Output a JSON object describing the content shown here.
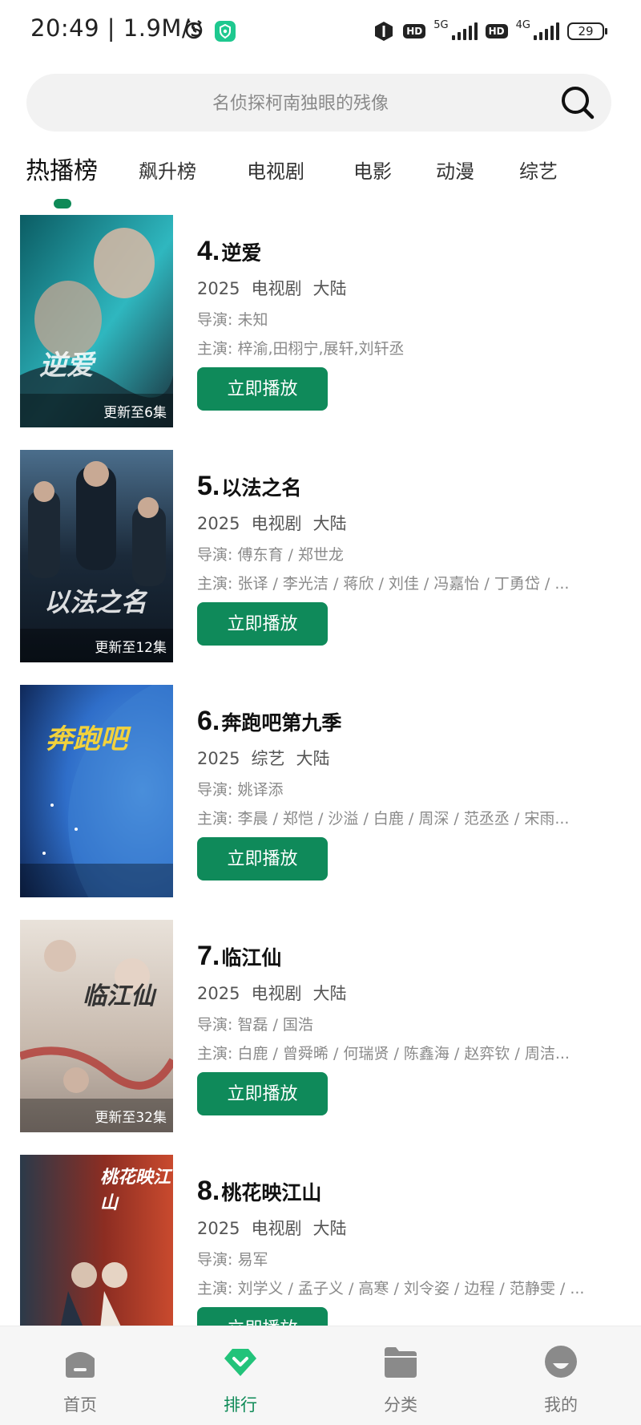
{
  "status_bar": {
    "time_speed": "20:49 | 1.9M/s",
    "hd_badge": "HD",
    "net_5g": "5G",
    "net_4g": "4G",
    "battery": "29"
  },
  "search": {
    "placeholder": "名侦探柯南独眼的残像"
  },
  "tabs": [
    {
      "label": "热播榜",
      "active": true
    },
    {
      "label": "飙升榜",
      "active": false
    },
    {
      "label": "电视剧",
      "active": false
    },
    {
      "label": "电影",
      "active": false
    },
    {
      "label": "动漫",
      "active": false
    },
    {
      "label": "综艺",
      "active": false
    }
  ],
  "items": [
    {
      "rank": "4.",
      "title": "逆爱",
      "year": "2025",
      "type": "电视剧",
      "region": "大陆",
      "director": "导演: 未知",
      "cast": "主演: 梓渝,田栩宁,展轩,刘轩丞",
      "badge": "更新至6集",
      "poster_text": "逆爱",
      "poster_colors": [
        "#0b5c63",
        "#2fb7bf",
        "#1a2f3a"
      ]
    },
    {
      "rank": "5.",
      "title": "以法之名",
      "year": "2025",
      "type": "电视剧",
      "region": "大陆",
      "director": "导演: 傅东育 / 郑世龙",
      "cast": "主演: 张译 / 李光洁 / 蒋欣 / 刘佳 / 冯嘉怡 / 丁勇岱 / ...",
      "badge": "更新至12集",
      "poster_text": "以法之名",
      "poster_colors": [
        "#1b2a3a",
        "#4b6e8c",
        "#0d1620"
      ]
    },
    {
      "rank": "6.",
      "title": "奔跑吧第九季",
      "year": "2025",
      "type": "综艺",
      "region": "大陆",
      "director": "导演: 姚译添",
      "cast": "主演: 李晨 / 郑恺 / 沙溢 / 白鹿 / 周深 / 范丞丞 / 宋雨...",
      "badge": "",
      "poster_text": "奔跑吧",
      "poster_colors": [
        "#0b1f4a",
        "#2f6ec9",
        "#5aa0e6"
      ]
    },
    {
      "rank": "7.",
      "title": "临江仙",
      "year": "2025",
      "type": "电视剧",
      "region": "大陆",
      "director": "导演: 智磊 / 国浩",
      "cast": "主演: 白鹿 / 曾舜晞 / 何瑞贤 / 陈鑫海 / 赵弈钦 / 周洁...",
      "badge": "更新至32集",
      "poster_text": "临江仙",
      "poster_colors": [
        "#e9e2da",
        "#c7b9ad",
        "#b23a35"
      ]
    },
    {
      "rank": "8.",
      "title": "桃花映江山",
      "year": "2025",
      "type": "电视剧",
      "region": "大陆",
      "director": "导演: 易军",
      "cast": "主演: 刘学义 / 孟子义 / 高寒 / 刘令姿 / 边程 / 范静雯 / ...",
      "badge": "",
      "poster_text": "桃花映江山",
      "poster_colors": [
        "#2b3a4a",
        "#8c2d22",
        "#c94a2e"
      ]
    }
  ],
  "play_label": "立即播放",
  "nav": [
    {
      "label": "首页",
      "icon": "home-icon",
      "active": false
    },
    {
      "label": "排行",
      "icon": "ranking-icon",
      "active": true
    },
    {
      "label": "分类",
      "icon": "folder-icon",
      "active": false
    },
    {
      "label": "我的",
      "icon": "profile-icon",
      "active": false
    }
  ],
  "colors": {
    "accent": "#0e8a57",
    "button": "#0f8a5a"
  }
}
